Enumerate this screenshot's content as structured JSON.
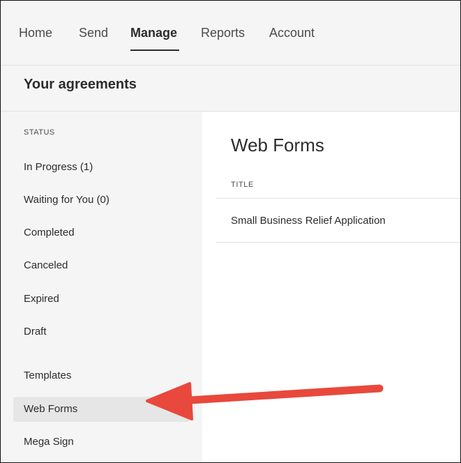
{
  "nav": {
    "items": [
      {
        "label": "Home"
      },
      {
        "label": "Send"
      },
      {
        "label": "Manage"
      },
      {
        "label": "Reports"
      },
      {
        "label": "Account"
      }
    ],
    "active": "Manage"
  },
  "header": {
    "title": "Your agreements"
  },
  "sidebar": {
    "status_label": "STATUS",
    "items": [
      {
        "label": "In Progress (1)"
      },
      {
        "label": "Waiting for You (0)"
      },
      {
        "label": "Completed"
      },
      {
        "label": "Canceled"
      },
      {
        "label": "Expired"
      },
      {
        "label": "Draft"
      },
      {
        "label": "Templates"
      },
      {
        "label": "Web Forms"
      },
      {
        "label": "Mega Sign"
      }
    ],
    "selected": "Web Forms"
  },
  "main": {
    "title": "Web Forms",
    "column_header": "TITLE",
    "rows": [
      {
        "title": "Small Business Relief Application"
      }
    ]
  },
  "annotation": {
    "arrow_color": "#e8493c",
    "arrow_icon": "arrow-left-icon"
  }
}
